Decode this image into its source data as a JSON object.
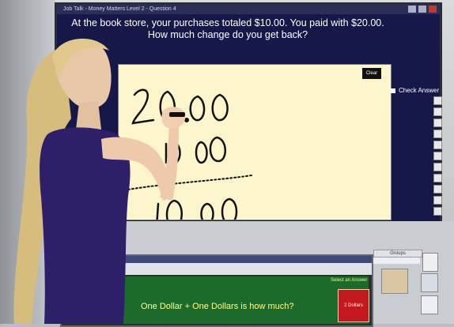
{
  "window": {
    "title": "Job Talk - Money Matters Level 2 - Question 4"
  },
  "question": {
    "text": "At the book store, your purchases totaled $10.00.  You paid with $20.00.  How much change do you get back?"
  },
  "whiteboard": {
    "clear_label": "Clear",
    "handwriting": [
      "20.00",
      "10.00",
      "10.00"
    ]
  },
  "check_answer": {
    "label": "Check Answer"
  },
  "secondary_app": {
    "question": "One Dollar + One Dollars is how much?",
    "select_label": "Select an Answer",
    "answer_button": "2 Dollars",
    "panel_label": "Groups"
  },
  "colors": {
    "screen_bg": "#151848",
    "whiteboard_bg": "#fdf6cc",
    "answer_green": "#1c6b2a",
    "answer_red": "#c3191f"
  }
}
